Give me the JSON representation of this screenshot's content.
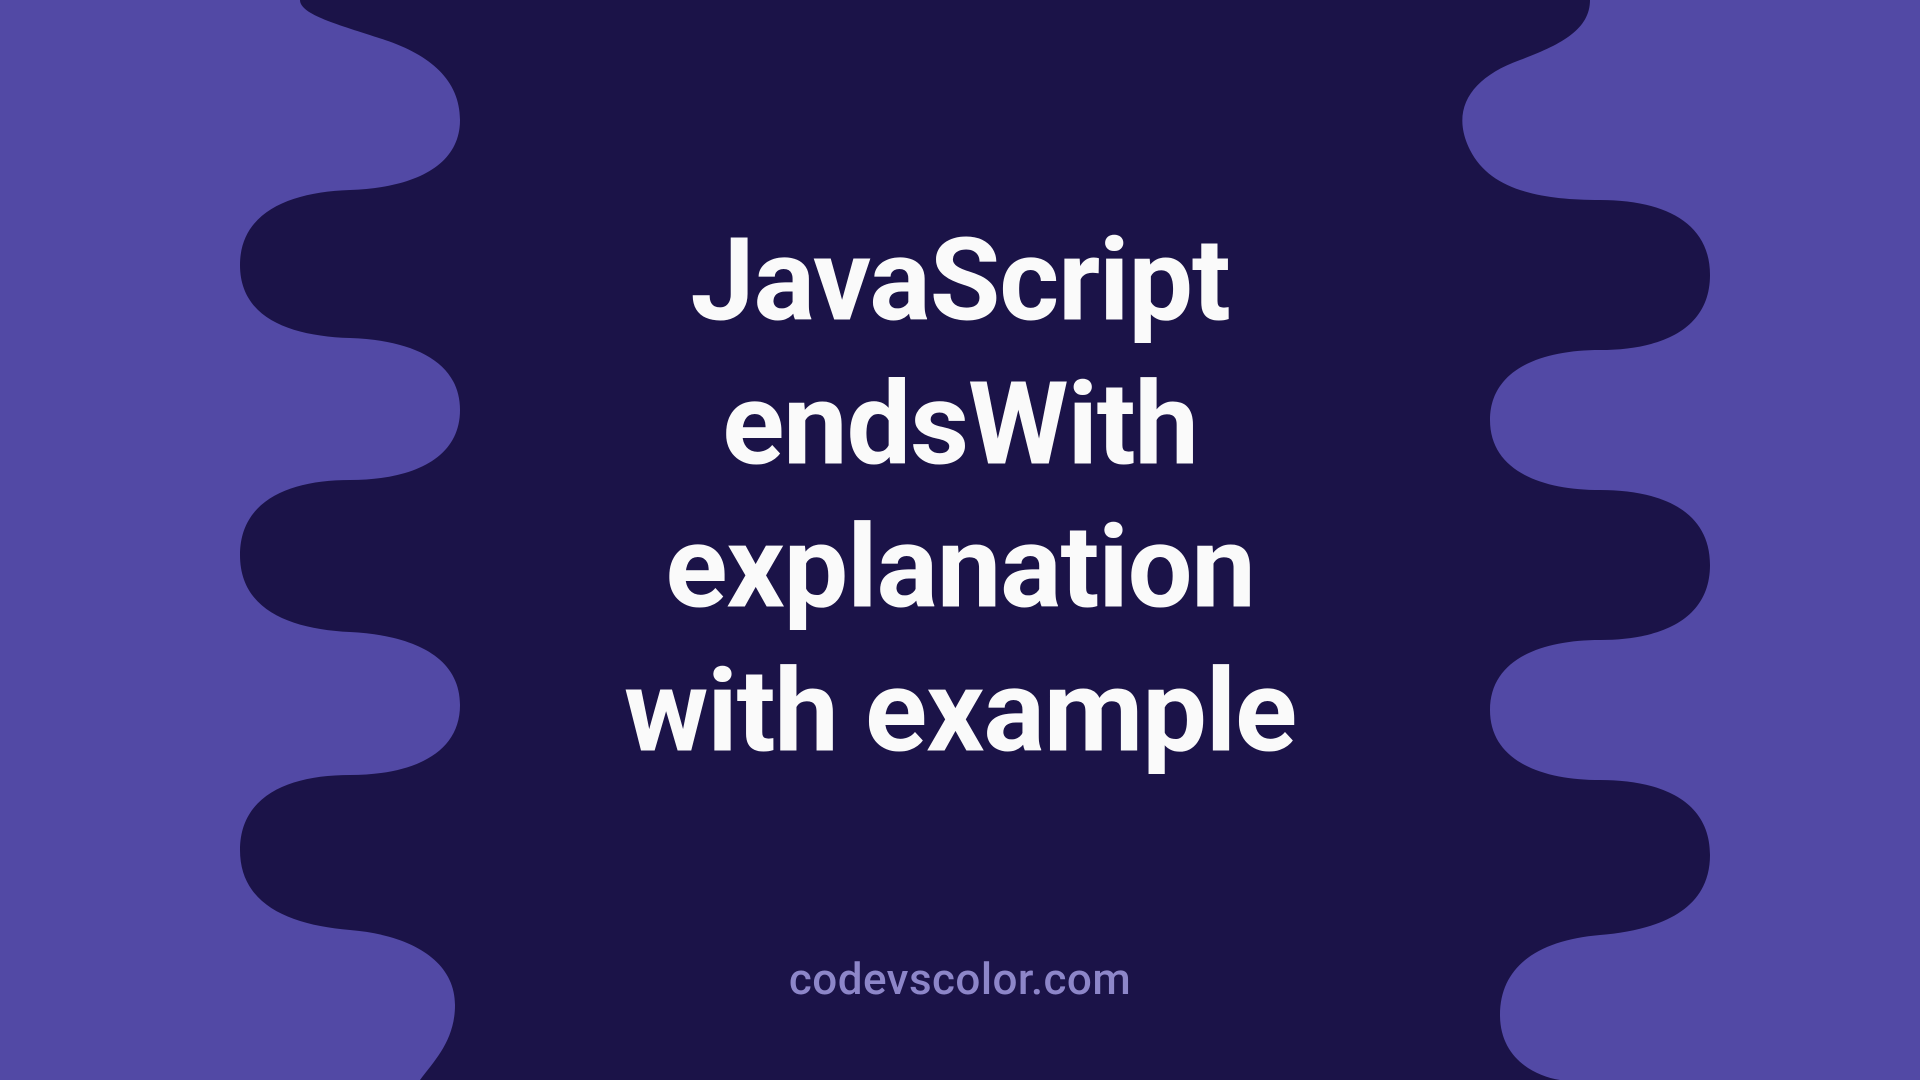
{
  "title": {
    "line1": "JavaScript",
    "line2": "endsWith",
    "line3": "explanation",
    "line4": "with example"
  },
  "watermark": "codevscolor.com",
  "colors": {
    "outer": "#5249A5",
    "blob": "#1B1348",
    "text": "#FAFAFA",
    "mark": "#8D86C9"
  }
}
